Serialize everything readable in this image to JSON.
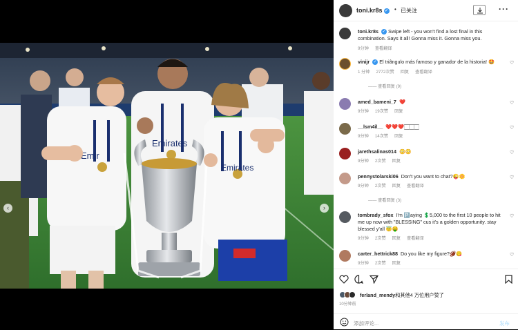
{
  "post": {
    "username": "toni.kr8s",
    "follow_label": "已关注",
    "dot": "•",
    "verified_mark": "✓",
    "more_label": "···"
  },
  "caption": {
    "username": "toni.kr8s",
    "text": "Swipe left - you won't find a lost final in this combination. Says it all! Gonna miss it. Gonna miss you.",
    "time": "9分钟",
    "translate": "查看翻译"
  },
  "comments": [
    {
      "username": "vinijr",
      "text": "El triângulo más famoso y ganador de la historia! 🤩",
      "time": "1 分钟",
      "likes": "2772次赞",
      "reply": "回复",
      "translate": "查看翻译",
      "replies": "查看回复 (9)",
      "avatar_color": "#6b4e2e"
    },
    {
      "username": "amed_bameni_7",
      "text": "❤️",
      "time": "9分钟",
      "likes": "19次赞",
      "reply": "回复",
      "translate": "",
      "replies": "",
      "avatar_color": "#8a7bb0"
    },
    {
      "username": "__lsm4il__",
      "text": "❤️❤️❤️🏻🏻🏻",
      "time": "9分钟",
      "likes": "14次赞",
      "reply": "回复",
      "translate": "",
      "replies": "",
      "avatar_color": "#7a6a4a"
    },
    {
      "username": "jarethsalinas014",
      "text": "😳😳",
      "time": "9分钟",
      "likes": "2次赞",
      "reply": "回复",
      "translate": "",
      "replies": "",
      "avatar_color": "#9a2020"
    },
    {
      "username": "pennystolarski06",
      "text": "Don't you want to chat?😜🌼",
      "time": "9分钟",
      "likes": "2次赞",
      "reply": "回复",
      "translate": "查看翻译",
      "replies": "查看回复 (3)",
      "avatar_color": "#c49a8a"
    },
    {
      "username": "tombrady_sfox",
      "text": "I'm 🅿️aying 💲5,000 to the first 10 people to hit me up now with \"BLESSING\" cus it's a golden opportunity. stay blessed y'all 😇🤑",
      "time": "9分钟",
      "likes": "2次赞",
      "reply": "回复",
      "translate": "查看翻译",
      "replies": "",
      "avatar_color": "#555a60"
    },
    {
      "username": "carter_hettrick88",
      "text": "Do you like my figure?🏈😋",
      "time": "9分钟",
      "likes": "2次赞",
      "reply": "回复",
      "translate": "",
      "replies": "",
      "avatar_color": "#b07a60"
    }
  ],
  "actions": {
    "likes_user": "ferland_mendy",
    "likes_rest": "和其他4 万位用户赞了",
    "time_ago": "10分钟前",
    "add_comment_placeholder": "添加评论...",
    "post_label": "发布"
  },
  "nav": {
    "prev": "‹",
    "next": "›"
  },
  "colors": {
    "verified": "#3897f0",
    "heart_red": "#ed4956",
    "muted": "#8e8e8e",
    "pitch": "#3f8a3a"
  }
}
